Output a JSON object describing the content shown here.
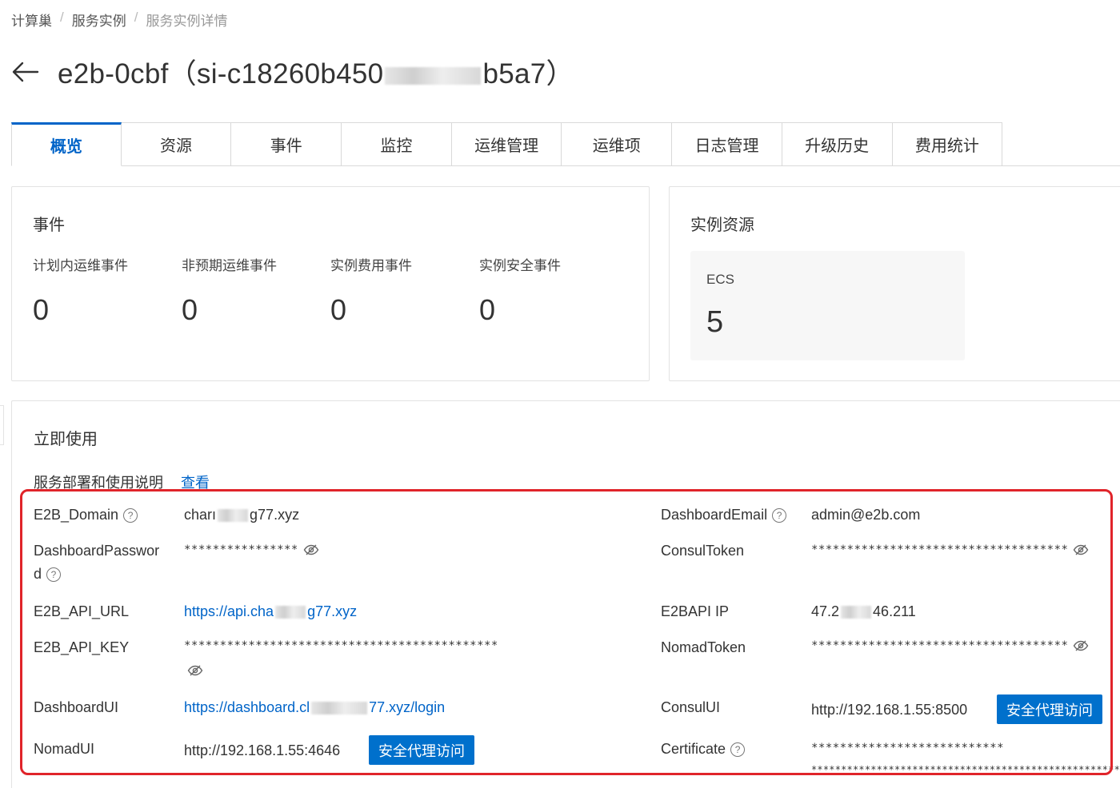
{
  "breadcrumb": {
    "item1": "计算巢",
    "item2": "服务实例",
    "current": "服务实例详情",
    "sep": "/"
  },
  "title": {
    "prefix": "e2b-0cbf（si-c18260b450",
    "suffix": "b5a7）"
  },
  "tabs": [
    {
      "label": "概览"
    },
    {
      "label": "资源"
    },
    {
      "label": "事件"
    },
    {
      "label": "监控"
    },
    {
      "label": "运维管理"
    },
    {
      "label": "运维项"
    },
    {
      "label": "日志管理"
    },
    {
      "label": "升级历史"
    },
    {
      "label": "费用统计"
    }
  ],
  "events": {
    "title": "事件",
    "items": [
      {
        "label": "计划内运维事件",
        "value": "0"
      },
      {
        "label": "非预期运维事件",
        "value": "0"
      },
      {
        "label": "实例费用事件",
        "value": "0"
      },
      {
        "label": "实例安全事件",
        "value": "0"
      }
    ]
  },
  "resources": {
    "title": "实例资源",
    "ecs_label": "ECS",
    "ecs_value": "5"
  },
  "usage": {
    "title": "立即使用",
    "doc_label": "服务部署和使用说明",
    "doc_link": "查看",
    "proxy_button": "安全代理访问",
    "fields": {
      "e2b_domain": {
        "key": "E2B_Domain",
        "value_a": "charı",
        "value_b": "g77.xyz"
      },
      "dashboard_email": {
        "key": "DashboardEmail",
        "value": "admin@e2b.com"
      },
      "dashboard_password": {
        "key_a": "DashboardPasswor",
        "key_b": "d",
        "value": "****************"
      },
      "consul_token": {
        "key": "ConsulToken",
        "value": "************************************"
      },
      "e2b_api_url": {
        "key": "E2B_API_URL",
        "value_a": "https://api.cha",
        "value_b": "g77.xyz"
      },
      "e2bapi_ip": {
        "key": "E2BAPI IP",
        "value_a": "47.2",
        "value_b": "46.211"
      },
      "e2b_api_key": {
        "key": "E2B_API_KEY",
        "value": "********************************************"
      },
      "nomad_token": {
        "key": "NomadToken",
        "value": "************************************"
      },
      "dashboard_ui": {
        "key": "DashboardUI",
        "value_a": "https://dashboard.cl",
        "value_b": "77.xyz/login"
      },
      "consul_ui": {
        "key": "ConsulUI",
        "value": "http://192.168.1.55:8500"
      },
      "nomad_ui": {
        "key": "NomadUI",
        "value": "http://192.168.1.55:4646"
      },
      "certificate": {
        "key": "Certificate",
        "value_1": "***************************",
        "value_2": "******************************************************"
      }
    }
  },
  "colors": {
    "accent": "#0064c8",
    "button": "#0070cc",
    "highlight": "#e0242a"
  }
}
